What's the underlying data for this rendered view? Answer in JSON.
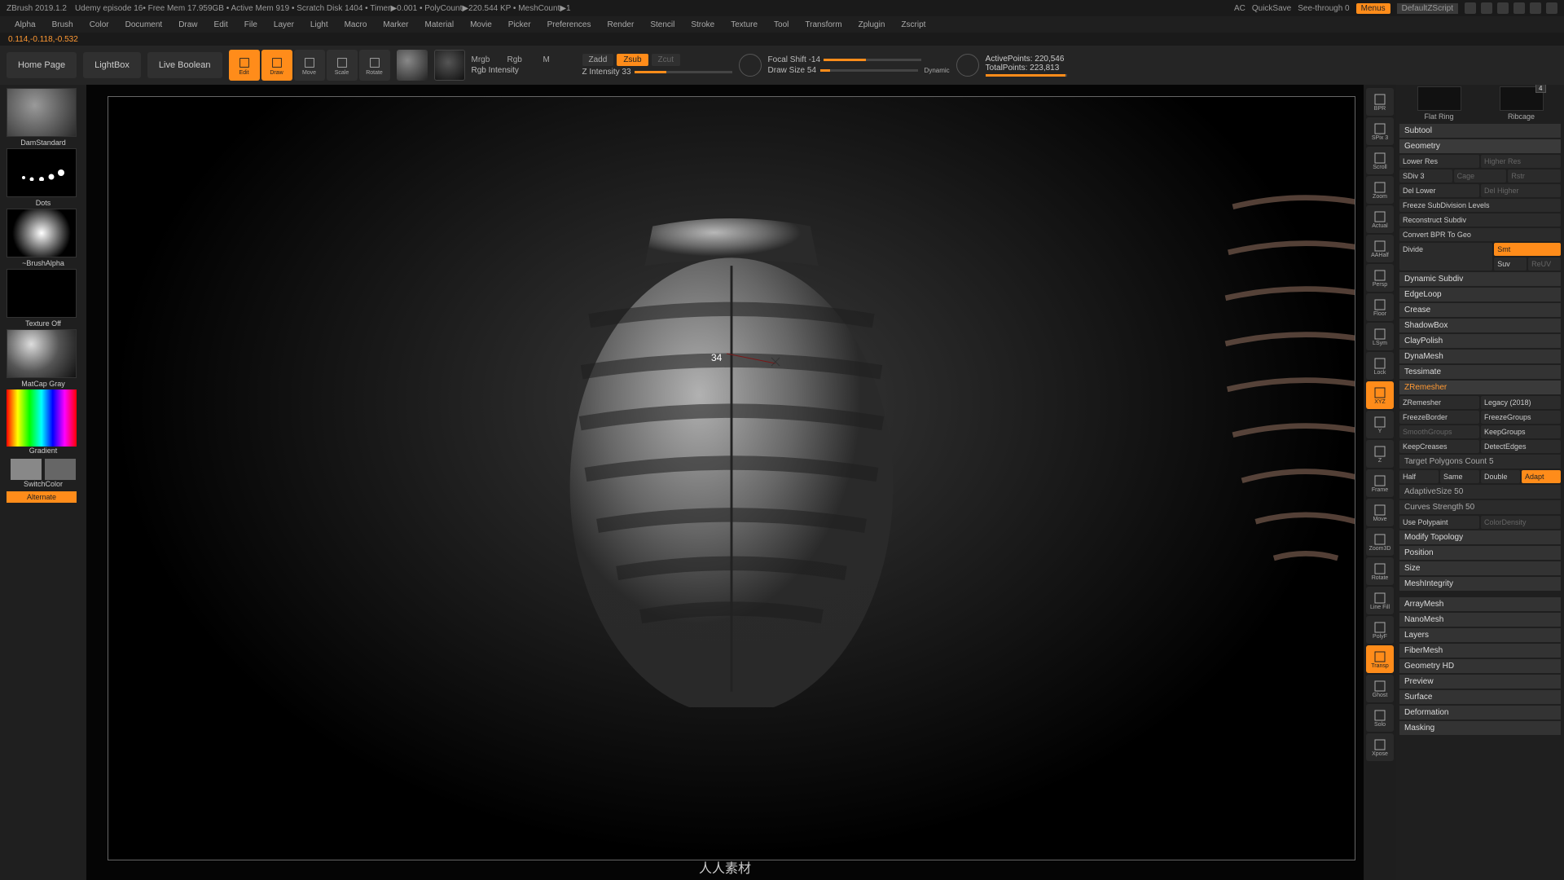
{
  "title_bar": {
    "app": "ZBrush 2019.1.2",
    "doc": "Udemy episode 16",
    "stats": "  • Free Mem 17.959GB • Active Mem 919 • Scratch Disk 1404 • Timer▶0.001 • PolyCount▶220.544 KP  • MeshCount▶1",
    "ac": "AC",
    "quicksave": "QuickSave",
    "seethrough": "See-through  0",
    "menus": "Menus",
    "zscript": "DefaultZScript"
  },
  "menus": [
    "Alpha",
    "Brush",
    "Color",
    "Document",
    "Draw",
    "Edit",
    "File",
    "Layer",
    "Light",
    "Macro",
    "Marker",
    "Material",
    "Movie",
    "Picker",
    "Preferences",
    "Render",
    "Stencil",
    "Stroke",
    "Texture",
    "Tool",
    "Transform",
    "Zplugin",
    "Zscript"
  ],
  "coords": "0.114,-0.118,-0.532",
  "shelf": {
    "home": "Home Page",
    "lightbox": "LightBox",
    "liveboolean": "Live Boolean",
    "tools": [
      "Edit",
      "Draw",
      "Move",
      "Scale",
      "Rotate"
    ],
    "mrgb": "Mrgb",
    "rgb": "Rgb",
    "m": "M",
    "rgb_label": "Rgb Intensity",
    "zadd": "Zadd",
    "zsub": "Zsub",
    "zcut": "Zcut",
    "zintensity_label": "Z Intensity 33",
    "focal": "Focal Shift -14",
    "drawsize": "Draw Size 54",
    "dynamic": "Dynamic",
    "active": "ActivePoints: 220,546",
    "total": "TotalPoints: 223,813"
  },
  "left_dock": {
    "brush": "DamStandard",
    "stroke": "Dots",
    "alpha": "~BrushAlpha",
    "texture": "Texture Off",
    "matcap": "MatCap Gray",
    "gradient": "Gradient",
    "switch": "SwitchColor",
    "alternate": "Alternate"
  },
  "canvas": {
    "cursor_value": "34",
    "watermark": "人人素材"
  },
  "right_toolbar": [
    "BPR",
    "SPix 3",
    "Scroll",
    "Zoom",
    "Actual",
    "AAHalf",
    "Persp",
    "Floor",
    "LSym",
    "Lock",
    "XYZ",
    "Y",
    "Z",
    "Frame",
    "Move",
    "Zoom3D",
    "Rotate",
    "Line Fill",
    "PolyF",
    "Transp",
    "Ghost",
    "Solo",
    "Xpose"
  ],
  "right_toolbar_active": {
    "XYZ": true,
    "Transp": true
  },
  "right_panel": {
    "top_thumbs": [
      {
        "label": "Flat Ring",
        "badge": ""
      },
      {
        "label": "Ribcage",
        "badge": "4"
      }
    ],
    "subtool": "Subtool",
    "geometry": "Geometry",
    "geom_rows": [
      [
        "Lower Res",
        "Higher Res"
      ],
      [
        "SDiv 3",
        "Cage",
        "Rstr"
      ],
      [
        "Del Lower",
        "Del Higher"
      ],
      [
        "Freeze SubDivision Levels"
      ],
      [
        "Reconstruct Subdiv"
      ],
      [
        "Convert BPR To Geo"
      ]
    ],
    "divide": "Divide",
    "smt": "Smt",
    "suv": "Suv",
    "reuv": "ReUV",
    "geom_sections": [
      "Dynamic Subdiv",
      "EdgeLoop",
      "Crease",
      "ShadowBox",
      "ClayPolish",
      "DynaMesh",
      "Tessimate"
    ],
    "zremesher": "ZRemesher",
    "zr_row1": [
      "ZRemesher",
      "Legacy (2018)"
    ],
    "zr_row2": [
      "FreezeBorder",
      "FreezeGroups"
    ],
    "zr_row3": [
      "SmoothGroups",
      "KeepGroups"
    ],
    "zr_row4": [
      "KeepCreases",
      "DetectEdges"
    ],
    "polycount": "Target Polygons Count 5",
    "hsd": [
      "Half",
      "Same",
      "Double",
      "Adapt"
    ],
    "adaptive": "AdaptiveSize 50",
    "curves": "Curves Strength 50",
    "polypaint_row": [
      "Use Polypaint",
      "ColorDensity"
    ],
    "sections2": [
      "Modify Topology",
      "Position",
      "Size",
      "MeshIntegrity"
    ],
    "sections3": [
      "ArrayMesh",
      "NanoMesh",
      "Layers",
      "FiberMesh",
      "Geometry HD",
      "Preview",
      "Surface",
      "Deformation",
      "Masking"
    ]
  }
}
